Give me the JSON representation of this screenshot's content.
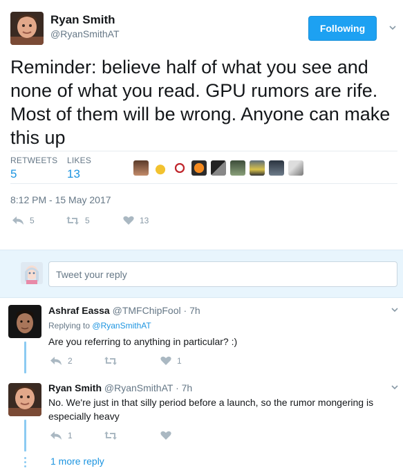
{
  "tweet": {
    "author_name": "Ryan Smith",
    "author_handle": "@RyanSmithAT",
    "follow_label": "Following",
    "text": "Reminder: believe half of what you see and none of what you read. GPU rumors are rife. Most of them will be wrong. Anyone can make this up",
    "retweets_label": "RETWEETS",
    "retweets_count": "5",
    "likes_label": "LIKES",
    "likes_count": "13",
    "timestamp": "8:12 PM - 15 May 2017",
    "actions": {
      "reply_count": "5",
      "retweet_count": "5",
      "like_count": "13"
    }
  },
  "reply_box": {
    "placeholder": "Tweet your reply"
  },
  "replies": [
    {
      "name": "Ashraf Eassa",
      "handle": "@TMFChipFool",
      "time": "· 7h",
      "replying_prefix": "Replying to",
      "replying_to": "@RyanSmithAT",
      "text": "Are you referring to anything in particular? :)",
      "reply_count": "2",
      "retweet_count": "",
      "like_count": "1"
    },
    {
      "name": "Ryan Smith",
      "handle": "@RyanSmithAT",
      "time": "· 7h",
      "text": "No. We're just in that silly period before a launch, so the rumor mongering is especially heavy",
      "reply_count": "1",
      "retweet_count": "",
      "like_count": ""
    }
  ],
  "more_replies": "1 more reply",
  "colors": {
    "accent": "#1da1f2",
    "link": "#1c94e0",
    "muted": "#657786",
    "reply_bg": "#e8f5fd"
  }
}
